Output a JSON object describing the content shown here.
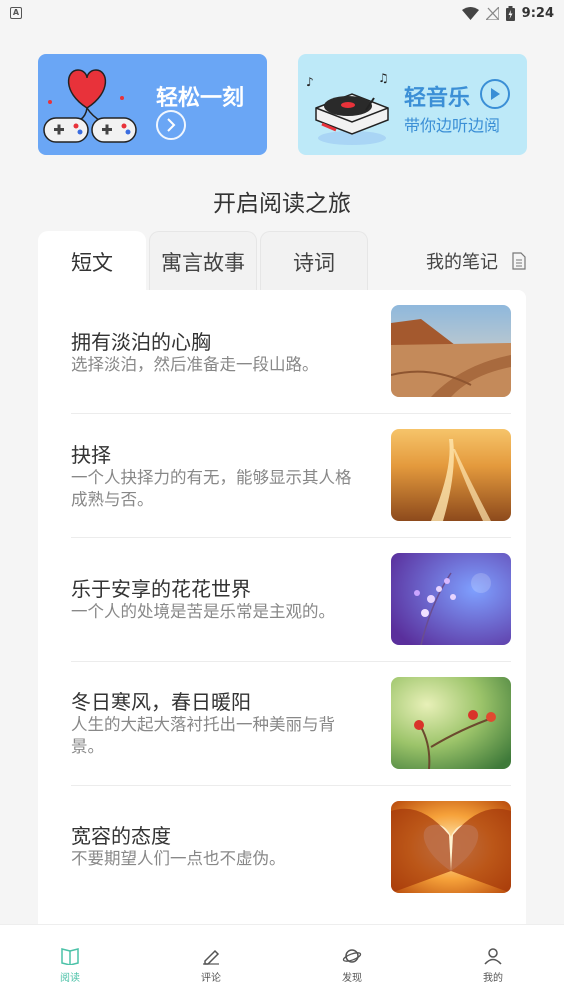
{
  "status_bar": {
    "time": "9:24",
    "left_icon_letter": "A"
  },
  "banners": {
    "left": {
      "title": "轻松一刻"
    },
    "right": {
      "title": "轻音乐",
      "subtitle": "带你边听边阅"
    }
  },
  "section_title": "开启阅读之旅",
  "tabs": [
    {
      "label": "短文",
      "active": true
    },
    {
      "label": "寓言故事",
      "active": false
    },
    {
      "label": "诗词",
      "active": false
    }
  ],
  "notes_label": "我的笔记",
  "articles": [
    {
      "title": "拥有淡泊的心胸",
      "desc": "选择淡泊，然后准备走一段山路。",
      "thumb": "desert-road"
    },
    {
      "title": "抉择",
      "desc": "一个人抉择力的有无，能够显示其人格成熟与否。",
      "thumb": "forked-road"
    },
    {
      "title": "乐于安享的花花世界",
      "desc": "一个人的处境是苦是乐常是主观的。",
      "thumb": "purple-flowers"
    },
    {
      "title": "冬日寒风，春日暖阳",
      "desc": "人生的大起大落衬托出一种美丽与背景。",
      "thumb": "red-berries"
    },
    {
      "title": "宽容的态度",
      "desc": "不要期望人们一点也不虚伪。",
      "thumb": "heart-hands"
    }
  ],
  "bottom_nav": [
    {
      "label": "阅读",
      "icon": "book-icon",
      "active": true
    },
    {
      "label": "评论",
      "icon": "pen-icon",
      "active": false
    },
    {
      "label": "发现",
      "icon": "planet-icon",
      "active": false
    },
    {
      "label": "我的",
      "icon": "user-icon",
      "active": false
    }
  ],
  "colors": {
    "accent": "#4cc2a8",
    "banner_blue": "#6aa6f5",
    "banner_light": "#bde9f8"
  }
}
